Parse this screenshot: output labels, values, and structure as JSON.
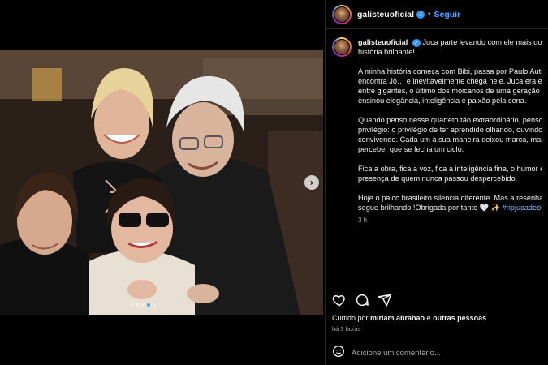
{
  "post": {
    "username": "galisteuoficial",
    "follow_label": "Seguir",
    "separator": "•"
  },
  "caption": {
    "username": "galisteuoficial",
    "lines": [
      "Juca parte levando com ele mais do que",
      "história brilhante!"
    ],
    "paragraphs": [
      [
        "A minha história começa com Bibi, passa por Paulo Autran",
        "encontra Jô… e inevitavelmente chega nele. Juca era esse e",
        "entre gigantes, o último dos moicanos de uma geração qu",
        "ensinou elegância, inteligência e paixão pela cena."
      ],
      [
        "Quando penso nesse quarteto tão extraordinário, penso e",
        "privilégio: o privilégio de ter aprendido olhando, ouvindo,",
        "convivendo. Cada um à sua maneira deixou marca, mas ho",
        "perceber que se fecha um ciclo."
      ],
      [
        "Fica a obra, fica a voz, fica a inteligência fina, o humor e a",
        "presença de quem nunca passou despercebido."
      ]
    ],
    "last_line_1": "Hoje o palco brasileiro silencia diferente. Mas a resenha no",
    "last_line_2_text": "segue brilhando !Obrigada por tanto ",
    "emoji_heart": "🤍",
    "emoji_sparkle": "✨",
    "hashtag": "#ripjucadeoliv",
    "time": "3 h"
  },
  "likes": {
    "prefix": "Curtido por ",
    "user": "miriam.abrahao",
    "middle": " e ",
    "others": "outras pessoas",
    "ago": "há 3 horas"
  },
  "comment": {
    "placeholder": "Adicione um comentário..."
  },
  "carousel": {
    "next_glyph": "›",
    "dot_count": 5,
    "active_dot": 3
  },
  "icons": [
    "heart-icon",
    "comment-icon",
    "share-icon",
    "emoji-icon",
    "verified-icon",
    "chevron-right-icon"
  ]
}
